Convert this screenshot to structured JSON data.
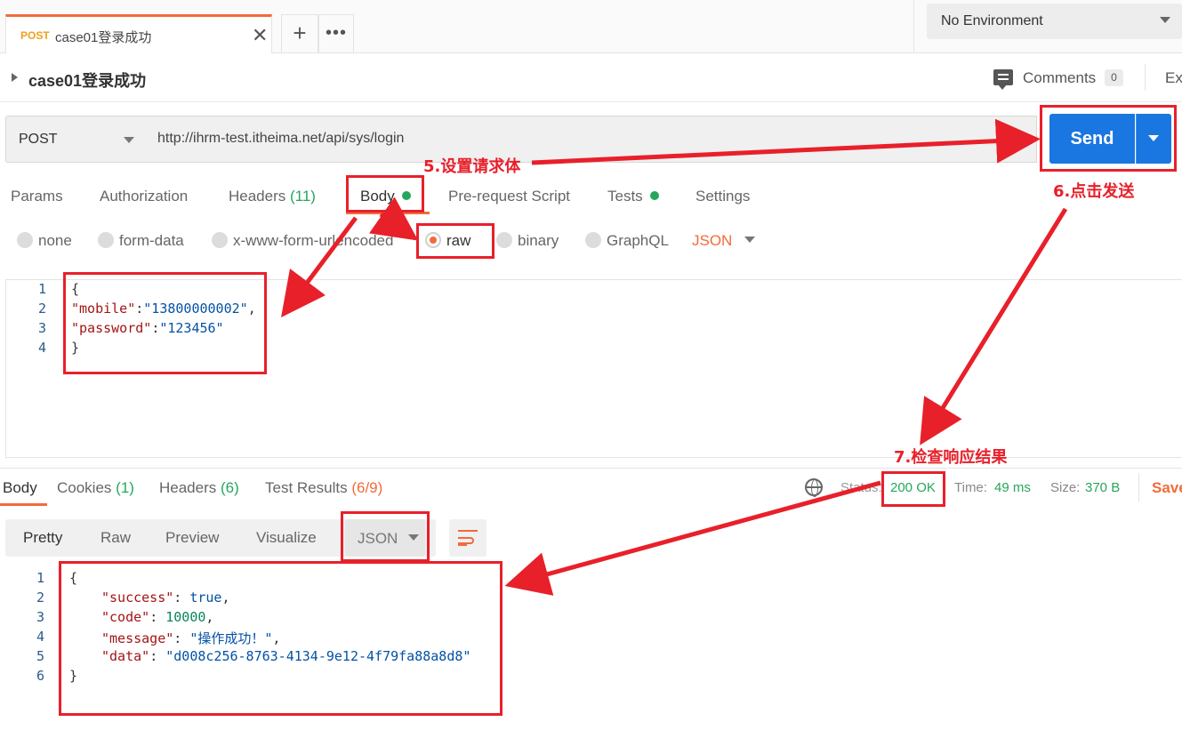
{
  "tab": {
    "method": "POST",
    "name": "case01登录成功",
    "close": "✕",
    "new": "+",
    "more": "•••"
  },
  "environment": {
    "selected": "No Environment"
  },
  "request_name": "case01登录成功",
  "comments": {
    "label": "Comments",
    "count": "0"
  },
  "export_label": "Ex",
  "request": {
    "method": "POST",
    "url": "http://ihrm-test.itheima.net/api/sys/login",
    "send_label": "Send"
  },
  "request_tabs": {
    "params": "Params",
    "authorization": "Authorization",
    "headers": "Headers",
    "headers_count": "(11)",
    "body": "Body",
    "pre_request": "Pre-request Script",
    "tests": "Tests",
    "settings": "Settings"
  },
  "body_modes": {
    "none": "none",
    "form_data": "form-data",
    "urlencoded": "x-www-form-urlencoded",
    "raw": "raw",
    "binary": "binary",
    "graphql": "GraphQL",
    "language": "JSON"
  },
  "request_body": {
    "line_numbers": [
      "1",
      "2",
      "3",
      "4"
    ],
    "open_brace": "{",
    "mobile_key": "\"mobile\"",
    "mobile_value": "\"13800000002\"",
    "password_key": "\"password\"",
    "password_value": "\"123456\"",
    "close_brace": "}"
  },
  "response_tabs": {
    "body": "Body",
    "cookies": "Cookies",
    "cookies_count": "(1)",
    "headers": "Headers",
    "headers_count": "(6)",
    "test_results": "Test Results",
    "test_results_count": "(6/9)"
  },
  "response_meta": {
    "status_label": "Status:",
    "status_value": "200 OK",
    "time_label": "Time:",
    "time_value": "49 ms",
    "size_label": "Size:",
    "size_value": "370 B",
    "save_label": "Save"
  },
  "response_views": {
    "pretty": "Pretty",
    "raw": "Raw",
    "preview": "Preview",
    "visualize": "Visualize",
    "format": "JSON"
  },
  "response_body": {
    "line_numbers": [
      "1",
      "2",
      "3",
      "4",
      "5",
      "6"
    ],
    "open_brace": "{",
    "success_key": "\"success\"",
    "success_value": "true",
    "code_key": "\"code\"",
    "code_value": "10000",
    "message_key": "\"message\"",
    "message_value": "\"操作成功！\"",
    "data_key": "\"data\"",
    "data_value": "\"d008c256-8763-4134-9e12-4f79fa88a8d8\"",
    "close_brace": "}"
  },
  "annotations": {
    "step5": "5.设置请求体",
    "step6": "6.点击发送",
    "step7": "7.检查响应结果"
  },
  "colors": {
    "accent": "#f26b3a",
    "send_blue": "#1a76e0",
    "status_green": "#26a65b",
    "annotation_red": "#e8202a"
  }
}
